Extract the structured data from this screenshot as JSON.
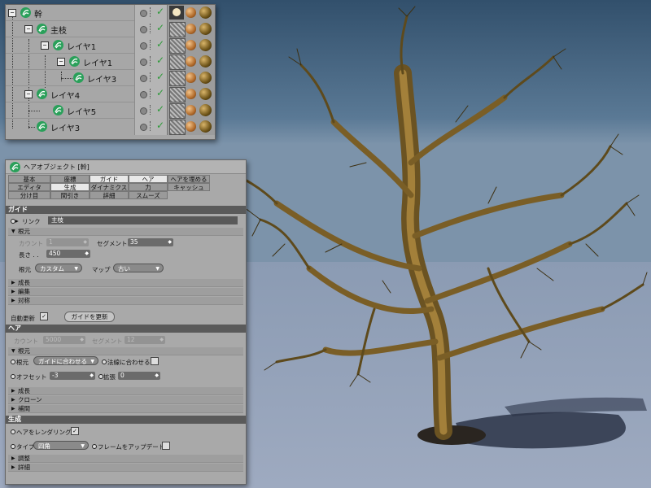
{
  "object_manager": {
    "rows": [
      {
        "name": "幹",
        "expander": "−"
      },
      {
        "name": "主枝",
        "expander": "−"
      },
      {
        "name": "レイヤ1",
        "expander": "−"
      },
      {
        "name": "レイヤ1",
        "expander": "−"
      },
      {
        "name": "レイヤ3",
        "expander": ""
      },
      {
        "name": "レイヤ4",
        "expander": "−"
      },
      {
        "name": "レイヤ5",
        "expander": ""
      },
      {
        "name": "レイヤ3",
        "expander": ""
      }
    ],
    "check_mark": "✓"
  },
  "attributes": {
    "title": "ヘアオブジェクト [幹]",
    "tabs_row1": [
      "基本",
      "座標",
      "ガイド",
      "ヘア",
      "ヘアを埋める"
    ],
    "tabs_row2": [
      "エディタ",
      "生成",
      "ダイナミクス",
      "力",
      "キャッシュ"
    ],
    "tabs_row3": [
      "分け目",
      "間引き",
      "詳細",
      "スムーズ"
    ],
    "guide": {
      "section": "ガイド",
      "link_label": "リンク",
      "link_value": "主枝",
      "root_group": "根元",
      "count_label": "カウント",
      "count_value": "1",
      "segment_label": "セグメント",
      "segment_value": "35",
      "length_label": "長さ . .",
      "length_value": "450",
      "root_label": "根元",
      "root_value": "カスタム",
      "map_label": "マップ",
      "map_value": "古い",
      "collapsed": [
        "成長",
        "編集",
        "対称"
      ],
      "auto_update_label": "自動更新",
      "update_button": "ガイドを更新"
    },
    "hair": {
      "section": "ヘア",
      "count_label": "カウント",
      "count_value": "5000",
      "segment_label": "セグメント",
      "segment_value": "12",
      "root_group": "根元",
      "root_label": "根元",
      "root_value": "ガイドに合わせる",
      "normal_label": "法線に合わせる",
      "offset_label": "オフセット",
      "offset_value": "-3",
      "extend_label": "拡張",
      "extend_value": "0",
      "collapsed": [
        "成長",
        "クローン",
        "補間"
      ]
    },
    "generate": {
      "section": "生成",
      "render_label": "ヘアをレンダリング",
      "type_label": "タイプ",
      "type_value": "四角",
      "frame_label": "フレームをアップデート",
      "collapsed": [
        "調整",
        "詳細"
      ]
    }
  }
}
